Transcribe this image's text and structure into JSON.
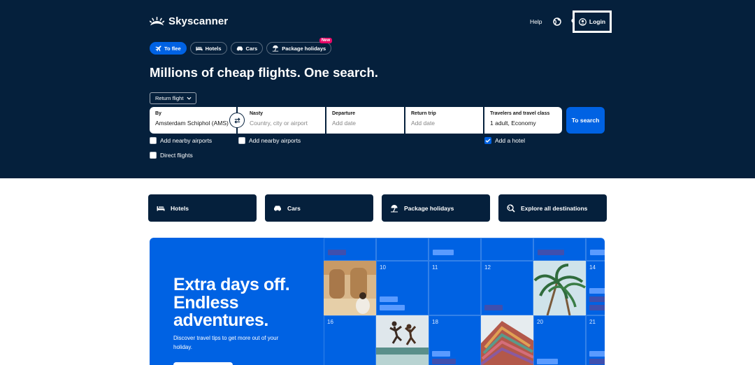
{
  "brand": {
    "name": "Skyscanner"
  },
  "header": {
    "help_label": "Help",
    "login_label": "Login"
  },
  "tabs": [
    {
      "label": "To flee",
      "icon": "plane-icon",
      "active": true
    },
    {
      "label": "Hotels",
      "icon": "bed-icon",
      "active": false
    },
    {
      "label": "Cars",
      "icon": "car-icon",
      "active": false
    },
    {
      "label": "Package holidays",
      "icon": "beach-icon",
      "active": false,
      "badge": "New"
    }
  ],
  "headline": "Millions of cheap flights. One search.",
  "trip_type": "Return flight",
  "search": {
    "from": {
      "label": "By",
      "value": "Amsterdam Schiphol (AMS)"
    },
    "to": {
      "label": "Nasty",
      "placeholder": "Country, city or airport"
    },
    "departure": {
      "label": "Departure",
      "placeholder": "Add date"
    },
    "return": {
      "label": "Return trip",
      "placeholder": "Add date"
    },
    "travelers": {
      "label": "Travelers and travel class",
      "value": "1 adult, Economy"
    },
    "button_label": "To search"
  },
  "options": {
    "nearby_from": {
      "label": "Add nearby airports",
      "checked": false
    },
    "nearby_to": {
      "label": "Add nearby airports",
      "checked": false
    },
    "direct": {
      "label": "Direct flights",
      "checked": false
    },
    "hotel": {
      "label": "Add a hotel",
      "checked": true
    }
  },
  "quick_links": [
    {
      "label": "Hotels",
      "icon": "bed-icon"
    },
    {
      "label": "Cars",
      "icon": "car-icon"
    },
    {
      "label": "Package holidays",
      "icon": "beach-icon"
    },
    {
      "label": "Explore all destinations",
      "icon": "globe-search-icon"
    }
  ],
  "promo": {
    "title_lines": [
      "Extra days off.",
      "Endless",
      "adventures."
    ],
    "subtitle": "Discover travel tips to get more out of your holiday.",
    "calendar_days": [
      "10",
      "11",
      "12",
      "14",
      "16",
      "18",
      "20",
      "21"
    ]
  },
  "colors": {
    "navy": "#05203c",
    "blue": "#0062e3",
    "pink": "#e70866"
  }
}
